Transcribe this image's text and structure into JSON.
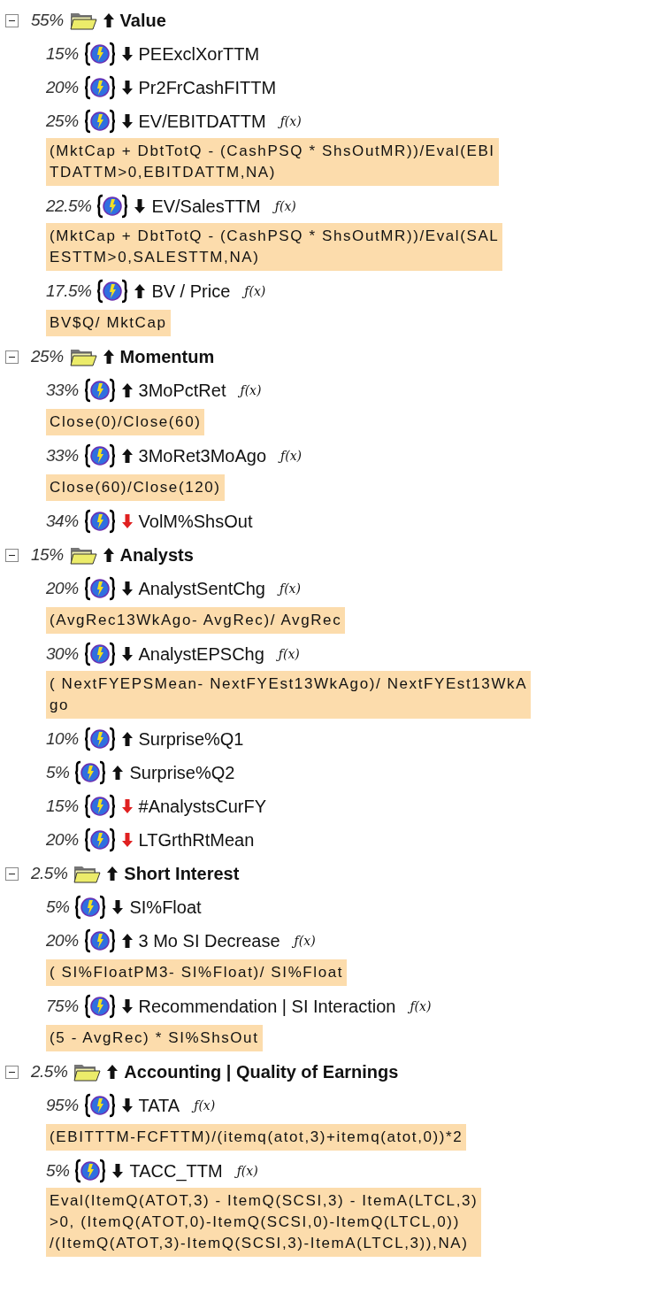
{
  "groups": [
    {
      "weight": "55%",
      "name": "Value",
      "ascending": true,
      "expanded": true,
      "factors": [
        {
          "weight": "15%",
          "name": "PEExclXorTTM",
          "ascending": false,
          "flagged": false
        },
        {
          "weight": "20%",
          "name": "Pr2FrCashFITTM",
          "ascending": false,
          "flagged": false
        },
        {
          "weight": "25%",
          "name": "EV/EBITDATTM",
          "ascending": false,
          "flagged": false,
          "formula_mark": "ƒ(x)",
          "formula_lines": [
            "(MktCap + DbtTotQ - (CashPSQ * ShsOutMR))/Eval(EBI",
            "TDATTM>0,EBITDATTM,NA)"
          ]
        },
        {
          "weight": "22.5%",
          "name": "EV/SalesTTM",
          "ascending": false,
          "flagged": false,
          "formula_mark": "ƒ(x)",
          "formula_lines": [
            "(MktCap + DbtTotQ - (CashPSQ * ShsOutMR))/Eval(SAL",
            "ESTTM>0,SALESTTM,NA)"
          ]
        },
        {
          "weight": "17.5%",
          "name": "BV / Price",
          "ascending": true,
          "flagged": false,
          "formula_mark": "ƒ(x)",
          "formula_lines": [
            "BV$Q/ MktCap"
          ]
        }
      ]
    },
    {
      "weight": "25%",
      "name": "Momentum",
      "ascending": true,
      "expanded": true,
      "factors": [
        {
          "weight": "33%",
          "name": "3MoPctRet",
          "ascending": true,
          "flagged": false,
          "formula_mark": "ƒ(x)",
          "formula_lines": [
            "Close(0)/Close(60)"
          ]
        },
        {
          "weight": "33%",
          "name": "3MoRet3MoAgo",
          "ascending": true,
          "flagged": false,
          "formula_mark": "ƒ(x)",
          "formula_lines": [
            "Close(60)/Close(120)"
          ]
        },
        {
          "weight": "34%",
          "name": "VolM%ShsOut",
          "ascending": false,
          "flagged": true
        }
      ]
    },
    {
      "weight": "15%",
      "name": "Analysts",
      "ascending": true,
      "expanded": true,
      "factors": [
        {
          "weight": "20%",
          "name": "AnalystSentChg",
          "ascending": false,
          "flagged": false,
          "formula_mark": "ƒ(x)",
          "formula_lines": [
            "(AvgRec13WkAgo- AvgRec)/ AvgRec"
          ]
        },
        {
          "weight": "30%",
          "name": "AnalystEPSChg",
          "ascending": false,
          "flagged": false,
          "formula_mark": "ƒ(x)",
          "formula_lines": [
            "( NextFYEPSMean- NextFYEst13WkAgo)/ NextFYEst13WkA",
            "go"
          ]
        },
        {
          "weight": "10%",
          "name": "Surprise%Q1",
          "ascending": true,
          "flagged": false
        },
        {
          "weight": "5%",
          "name": "Surprise%Q2",
          "ascending": true,
          "flagged": false
        },
        {
          "weight": "15%",
          "name": "#AnalystsCurFY",
          "ascending": false,
          "flagged": true
        },
        {
          "weight": "20%",
          "name": "LTGrthRtMean",
          "ascending": false,
          "flagged": true
        }
      ]
    },
    {
      "weight": "2.5%",
      "name": "Short Interest",
      "ascending": true,
      "expanded": true,
      "factors": [
        {
          "weight": "5%",
          "name": "SI%Float",
          "ascending": false,
          "flagged": false
        },
        {
          "weight": "20%",
          "name": "3 Mo SI Decrease",
          "ascending": true,
          "flagged": false,
          "formula_mark": "ƒ(x)",
          "formula_lines": [
            "( SI%FloatPM3- SI%Float)/ SI%Float"
          ]
        },
        {
          "weight": "75%",
          "name": "Recommendation | SI Interaction",
          "ascending": false,
          "flagged": false,
          "formula_mark": "ƒ(x)",
          "formula_lines": [
            "(5 - AvgRec) * SI%ShsOut"
          ]
        }
      ]
    },
    {
      "weight": "2.5%",
      "name": "Accounting | Quality of Earnings",
      "ascending": true,
      "expanded": true,
      "factors": [
        {
          "weight": "95%",
          "name": "TATA",
          "ascending": false,
          "flagged": false,
          "formula_mark": "ƒ(x)",
          "formula_lines": [
            "(EBITTTM-FCFTTM)/(itemq(atot,3)+itemq(atot,0))*2"
          ]
        },
        {
          "weight": "5%",
          "name": "TACC_TTM",
          "ascending": false,
          "flagged": false,
          "formula_mark": "ƒ(x)",
          "formula_lines": [
            "Eval(ItemQ(ATOT,3) - ItemQ(SCSI,3) - ItemA(LTCL,3)",
            ">0, (ItemQ(ATOT,0)-ItemQ(SCSI,0)-ItemQ(LTCL,0))",
            "/(ItemQ(ATOT,3)-ItemQ(SCSI,3)-ItemA(LTCL,3)),NA)"
          ]
        }
      ]
    }
  ]
}
